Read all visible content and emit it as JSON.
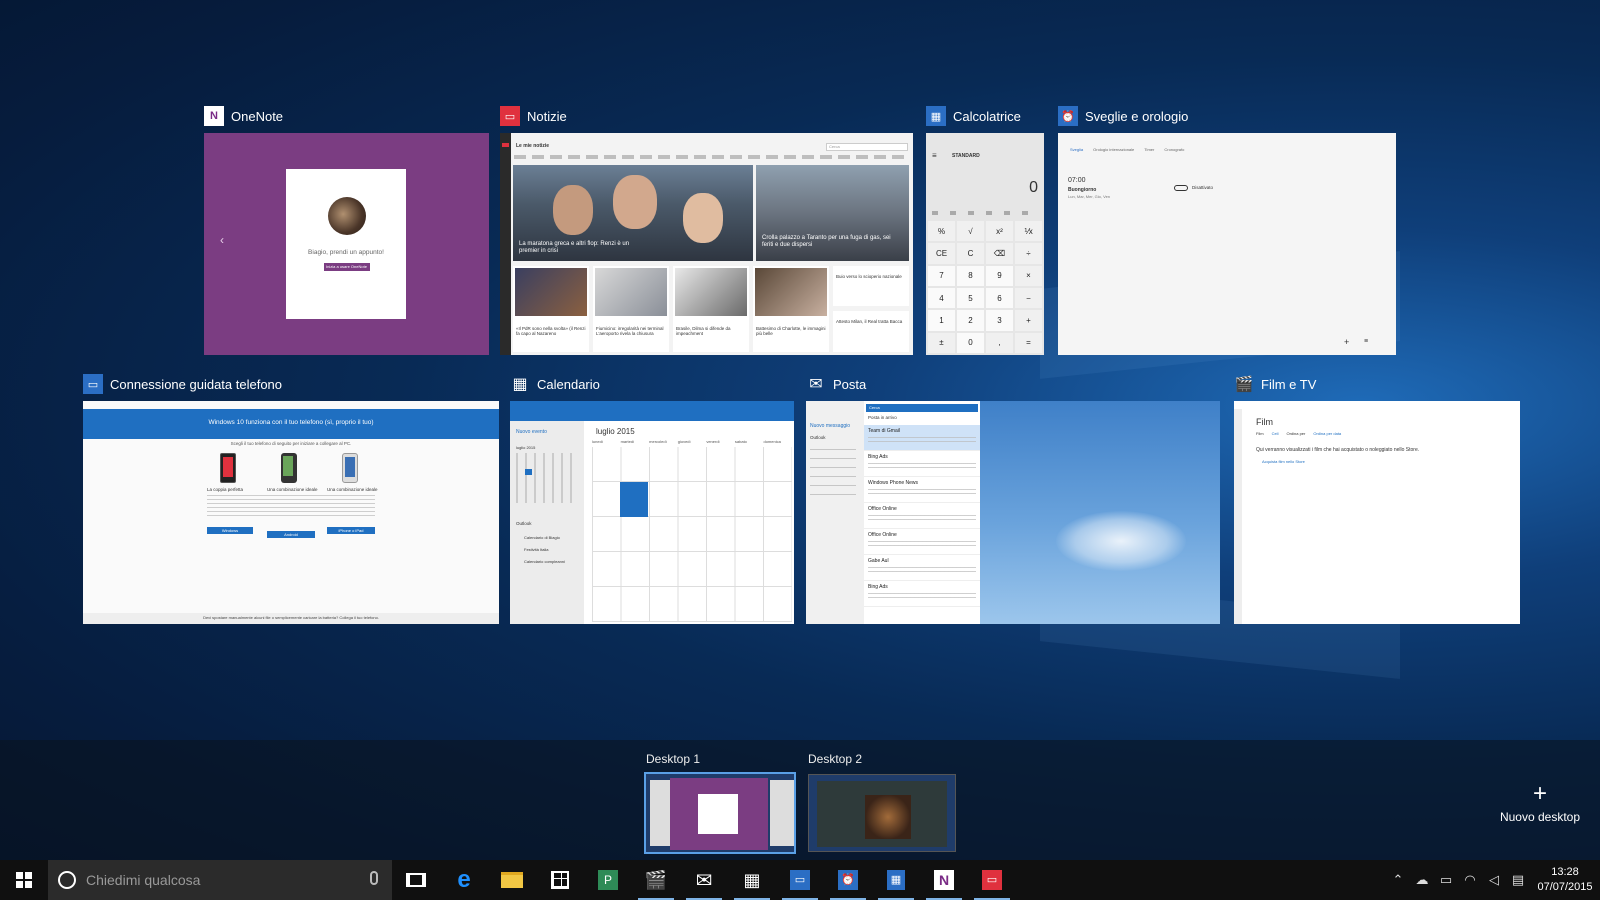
{
  "windows": {
    "onenote": {
      "title": "OneNote",
      "greeting": "Biagio, prendi un appunto!",
      "button": "Inizia a usare OneNote"
    },
    "notizie": {
      "title": "Notizie",
      "header": "Le mie notizie",
      "headline1": "La maratona greca e altri flop: Renzi è un premier in crisi",
      "headline2": "Crolla palazzo a Taranto per una fuga di gas, sei feriti e due dispersi",
      "item1": "«Il PdR sono nella svolta» (il Renzi fa capo al Nazareno",
      "item2": "Fiumicino: irregolarità nei terminal L'aeroporto rivela la chiusura",
      "item3": "Brasile, Dilma si difende da impeachment",
      "item4": "Battesimo di Charlotte, le immagini più belle",
      "item5": "Buio verso lo scioperio nazionale",
      "item6": "Attesto Milan, il Real tratta Bacca",
      "search": "Cerca"
    },
    "calcolatrice": {
      "title": "Calcolatrice",
      "mode": "STANDARD",
      "display": "0",
      "keys": [
        "%",
        "√",
        "x²",
        "⅟x",
        "CE",
        "C",
        "⌫",
        "÷",
        "7",
        "8",
        "9",
        "×",
        "4",
        "5",
        "6",
        "−",
        "1",
        "2",
        "3",
        "+",
        "±",
        "0",
        ",",
        "="
      ]
    },
    "sveglie": {
      "title": "Sveglie e orologio",
      "time": "07:00",
      "label": "Buongiorno",
      "days": "Lun, Mar, Mer, Gio, Ven",
      "status": "Disattivato",
      "tabs": [
        "Sveglia",
        "Orologio internazionale",
        "Timer",
        "Cronografo"
      ]
    },
    "connessione": {
      "title": "Connessione guidata telefono",
      "heading": "Windows 10 funziona con il tuo telefono (sì, proprio il tuo)",
      "sub": "Scegli il tuo telefono di seguito per iniziare a collegare al PC.",
      "opt1": "La coppia perfetta",
      "opt2": "Una combinazione ideale",
      "opt3": "Una combinazione ideale",
      "btn1": "Windows",
      "btn2": "Android",
      "btn3": "iPhone o iPad",
      "footer": "Devi spostare manualmente alcuni file o semplicemente caricare la batteria? Collega il tuo telefono."
    },
    "calendario": {
      "title": "Calendario",
      "month": "luglio 2015",
      "new_event": "Nuovo evento",
      "weekdays": [
        "lunedì",
        "martedì",
        "mercoledì",
        "giovedì",
        "venerdì",
        "sabato",
        "domenica"
      ],
      "mini_month": "luglio 2015",
      "section": "Outlook",
      "cal1": "Calendario di Biagio",
      "cal2": "Festività Italia",
      "cal3": "Calendario compleanni"
    },
    "posta": {
      "title": "Posta",
      "new_message": "Nuovo messaggio",
      "account": "Outlook",
      "folder": "Posta in arrivo",
      "search": "Cerca",
      "senders": [
        "Team di Gmail",
        "Bing Ads",
        "Windows Phone News",
        "Office Online",
        "Office Online",
        "Gabe Aul",
        "Bing Ads"
      ]
    },
    "film": {
      "title": "Film e TV",
      "heading": "Film",
      "tabs": [
        "Film",
        "Cell",
        "Ordina per",
        "Ordina per data"
      ],
      "message": "Qui verranno visualizzati i film che hai acquistato o noleggiato nello Store.",
      "link": "Acquista film nello Store"
    }
  },
  "desktops": {
    "d1": "Desktop 1",
    "d2": "Desktop 2",
    "new": "Nuovo desktop"
  },
  "taskbar": {
    "search_placeholder": "Chiedimi qualcosa",
    "time": "13:28",
    "date": "07/07/2015"
  }
}
